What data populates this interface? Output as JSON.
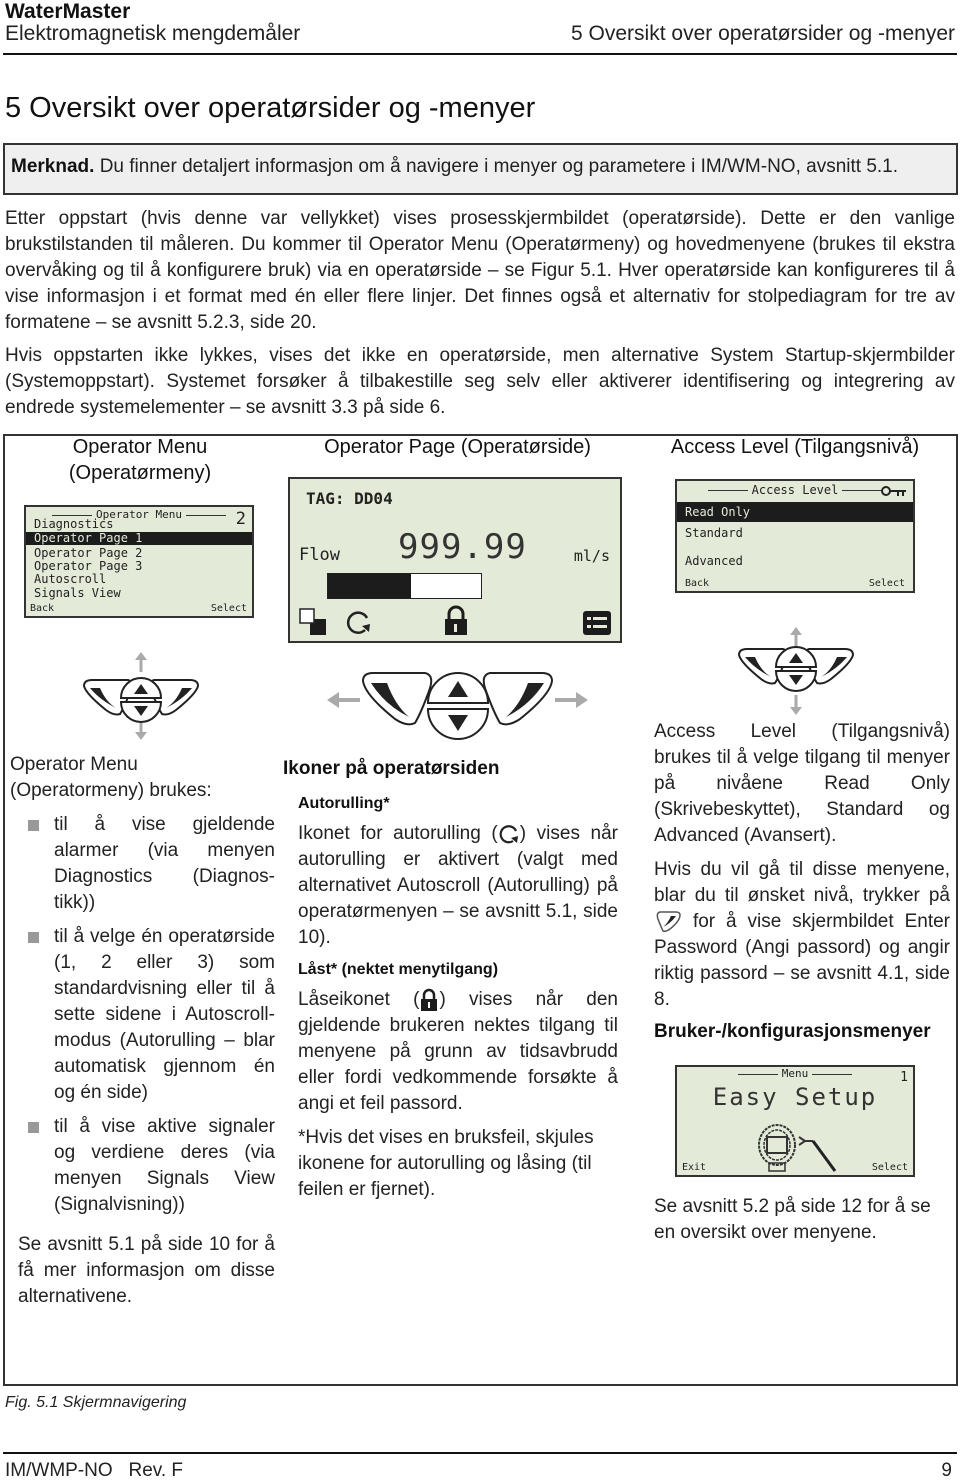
{
  "header": {
    "brand": "WaterMaster",
    "subtitle": "Elektromagnetisk mengdemåler",
    "section": "5  Oversikt over operatørsider og -menyer"
  },
  "title": "5  Oversikt over operatørsider og -menyer",
  "note": {
    "label": "Merknad.",
    "text": " Du finner detaljert informasjon om å navigere i menyer og parametere i IM/WM-NO, avsnitt 5.1."
  },
  "paragraphs": [
    "Etter oppstart (hvis denne var vellykket) vises prosesskjermbildet (operatørside). Dette er den vanlige brukstilstanden til måleren. Du kommer til Operator Menu (Operatørmeny) og hovedmenyene (brukes til ekstra overvåking og til å konfigurere bruk) via en operatørside – se Figur 5.1. Hver operatørside kan konfigureres til å vise informasjon i et format med én eller flere linjer. Det finnes også et alternativ for stolpediagram for tre av formatene – se avsnitt 5.2.3, side 20.",
    "Hvis oppstarten ikke lykkes, vises det ikke en operatørside, men alternative System Startup-skjermbilder (Systemoppstart). Systemet forsøker å tilbakestille seg selv eller aktiverer identifisering og integrering av endrede systemelementer – se avsnitt 3.3 på side 6."
  ],
  "figure": {
    "caption": "Fig. 5.1  Skjermnavigering",
    "operator_menu": {
      "title_line1": "Operator Menu",
      "title_line2": "(Operatørmeny)",
      "lcd": {
        "header": "Operator Menu",
        "page_number": "2",
        "items": [
          "Diagnostics",
          "Operator Page 1",
          "Operator Page 2",
          "Operator Page 3",
          "Autoscroll",
          "Signals View"
        ],
        "selected_index": 1,
        "left_soft_key": "Back",
        "right_soft_key": "Select"
      },
      "intro": "Operator Menu (Operatormeny) brukes:",
      "bullets": [
        "til å vise gjeldende alarmer (via menyen Diagnostics (Diagnos-tikk))",
        "til å velge én operatørside (1, 2 eller 3) som standardvisning eller til å sette sidene i Autoscroll-modus (Autorulling – blar automatisk gjennom én og én side)",
        "til å vise aktive signaler og verdiene deres (via menyen Signals View (Signalvisning))"
      ],
      "outro": "Se avsnitt 5.1 på side 10 for å få mer informasjon om disse alternativene."
    },
    "operator_page": {
      "title": "Operator Page (Operatørside)",
      "lcd": {
        "tag": "TAG: DD04",
        "label": "Flow",
        "value": "999.99",
        "unit": "ml/s",
        "bar_fill_fraction": 0.54,
        "icons": [
          "page-toggle-icon",
          "autoscroll-icon",
          "lock-icon",
          "menu-icon"
        ]
      },
      "icons_heading": "Ikoner på operatørsiden",
      "autoscroll_heading": "Autorulling*",
      "autoscroll_text_before": "Ikonet for autorulling (",
      "autoscroll_text_after": ") vises når autorulling er aktivert (valgt med alternativet Autoscroll (Autorulling) på operatørmenyen – se avsnitt 5.1, side 10).",
      "locked_heading": "Låst* (nektet menytilgang)",
      "locked_text_before": "Låseikonet (",
      "locked_text_after": ") vises når den gjeldende brukeren nektes tilgang til menyene på grunn av tidsavbrudd eller fordi vedkommende forsøkte å angi et feil passord.",
      "footnote": "*Hvis det vises en bruksfeil, skjules ikonene for autorulling og låsing (til feilen er fjernet)."
    },
    "access_level": {
      "title": "Access Level (Tilgangsnivå)",
      "lcd": {
        "header": "Access Level",
        "items": [
          "Read Only",
          "Standard",
          "Advanced"
        ],
        "selected_index": 0,
        "left_soft_key": "Back",
        "right_soft_key": "Select"
      },
      "text1": "Access Level (Tilgangsnivå) brukes til å velge tilgang til menyer på nivåene Read Only (Skrivebeskyttet), Standard og Advanced (Avansert).",
      "text2_before": "Hvis du vil gå til disse menyene, blar du til  ønsket nivå, trykker på ",
      "text2_after": " for å vise skjermbildet Enter Password (Angi passord) og angir riktig passord – se avsnitt 4.1, side 8.",
      "config_heading": "Bruker-/konfigurasjonsmenyer",
      "menu_lcd": {
        "header": "Menu",
        "page_number": "1",
        "title": "Easy Setup",
        "left_soft_key": "Exit",
        "right_soft_key": "Select"
      },
      "text3": "Se avsnitt 5.2 på side 12 for å se en oversikt over menyene."
    }
  },
  "footer": {
    "doc_id": "IM/WMP-NO   Rev. F",
    "page": "9"
  }
}
